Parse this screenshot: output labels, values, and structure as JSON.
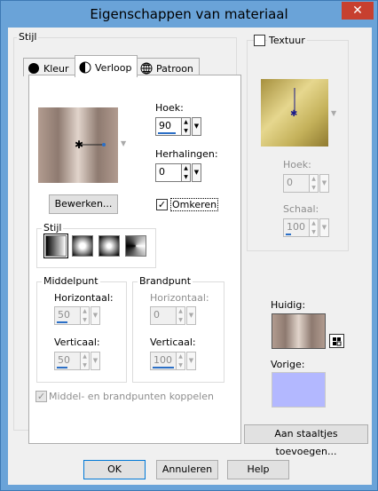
{
  "window": {
    "title": "Eigenschappen van materiaal",
    "close_glyph": "✕"
  },
  "style_group": {
    "label": "Stijl"
  },
  "tabs": [
    {
      "label": "Kleur",
      "icon": "filled-circle-icon"
    },
    {
      "label": "Verloop",
      "icon": "half-circle-icon"
    },
    {
      "label": "Patroon",
      "icon": "globe-pattern-icon"
    }
  ],
  "gradient": {
    "angle_label": "Hoek:",
    "angle_value": "90",
    "repeats_label": "Herhalingen:",
    "repeats_value": "0",
    "edit_label": "Bewerken...",
    "invert_label": "Omkeren",
    "invert_checked": true,
    "style_label": "Stijl"
  },
  "center_point": {
    "label": "Middelpunt",
    "horizontal_label": "Horizontaal:",
    "horizontal_value": "50",
    "vertical_label": "Verticaal:",
    "vertical_value": "50"
  },
  "focal_point": {
    "label": "Brandpunt",
    "horizontal_label": "Horizontaal:",
    "horizontal_value": "0",
    "vertical_label": "Verticaal:",
    "vertical_value": "100"
  },
  "link_points": {
    "label": "Middel- en brandpunten koppelen",
    "checked": true
  },
  "texture": {
    "label": "Textuur",
    "checked": false,
    "angle_label": "Hoek:",
    "angle_value": "0",
    "scale_label": "Schaal:",
    "scale_value": "100"
  },
  "current": {
    "label": "Huidig:"
  },
  "previous": {
    "label": "Vorige:"
  },
  "add_swatches_label": "Aan staaltjes toevoegen...",
  "buttons": {
    "ok": "OK",
    "cancel": "Annuleren",
    "help": "Help"
  },
  "colors": {
    "title_bar": "#6aa3d8",
    "previous_swatch": "#b3b8ff",
    "texture_gold": "#c9b768"
  }
}
